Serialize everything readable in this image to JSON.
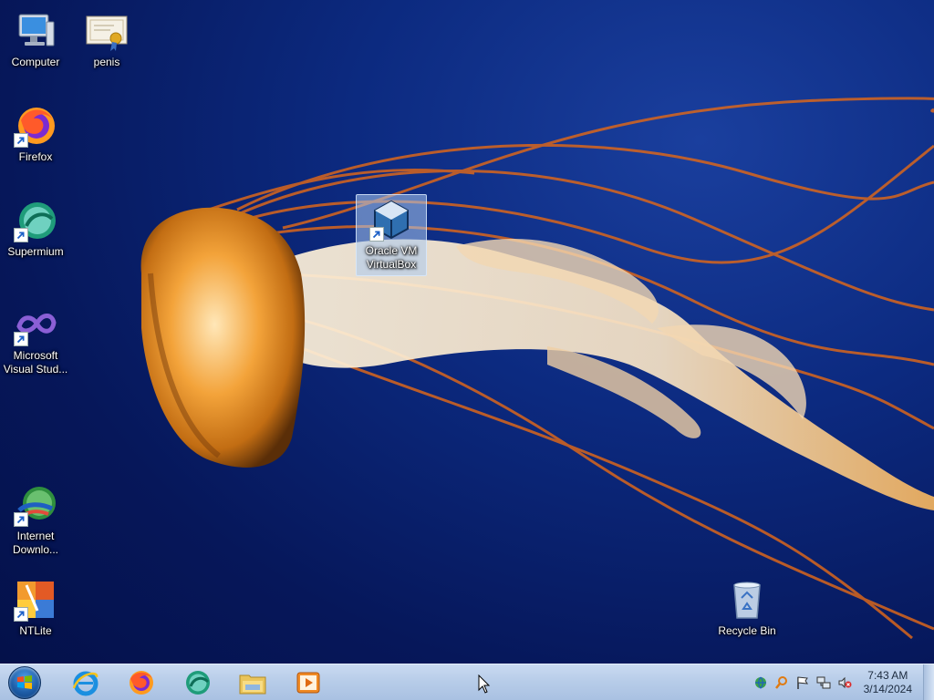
{
  "desktop_icons": [
    {
      "label": "Computer",
      "icon": "computer-icon",
      "shortcut": false
    },
    {
      "label": "penis",
      "icon": "certificate-icon",
      "shortcut": false
    },
    {
      "label": "Firefox",
      "icon": "firefox-icon",
      "shortcut": true
    },
    {
      "label": "Supermium",
      "icon": "supermium-icon",
      "shortcut": true
    },
    {
      "label": "Microsoft Visual Stud...",
      "icon": "visual-studio-icon",
      "shortcut": true
    },
    {
      "label": "Oracle VM VirtualBox",
      "icon": "virtualbox-icon",
      "shortcut": true,
      "selected": true
    },
    {
      "label": "Internet Downlo...",
      "icon": "internet-download-manager-icon",
      "shortcut": true
    },
    {
      "label": "NTLite",
      "icon": "ntlite-icon",
      "shortcut": true
    },
    {
      "label": "Recycle Bin",
      "icon": "recycle-bin-icon",
      "shortcut": false
    }
  ],
  "taskbar": {
    "start": {
      "icon": "windows-start-icon"
    },
    "pinned": [
      {
        "icon": "internet-explorer-icon"
      },
      {
        "icon": "firefox-icon"
      },
      {
        "icon": "supermium-icon"
      },
      {
        "icon": "file-explorer-icon"
      },
      {
        "icon": "media-player-icon"
      }
    ],
    "tray": [
      {
        "icon": "network-globe-icon"
      },
      {
        "icon": "search-tool-icon"
      },
      {
        "icon": "action-center-flag-icon"
      },
      {
        "icon": "network-icon"
      },
      {
        "icon": "volume-muted-icon"
      }
    ],
    "clock": {
      "time": "7:43 AM",
      "date": "3/14/2024"
    }
  },
  "colors": {
    "desktop_bg": "#0c2a80",
    "taskbar_bg": "#b8cde9",
    "icon_selected_bg": "#aac8f0"
  }
}
